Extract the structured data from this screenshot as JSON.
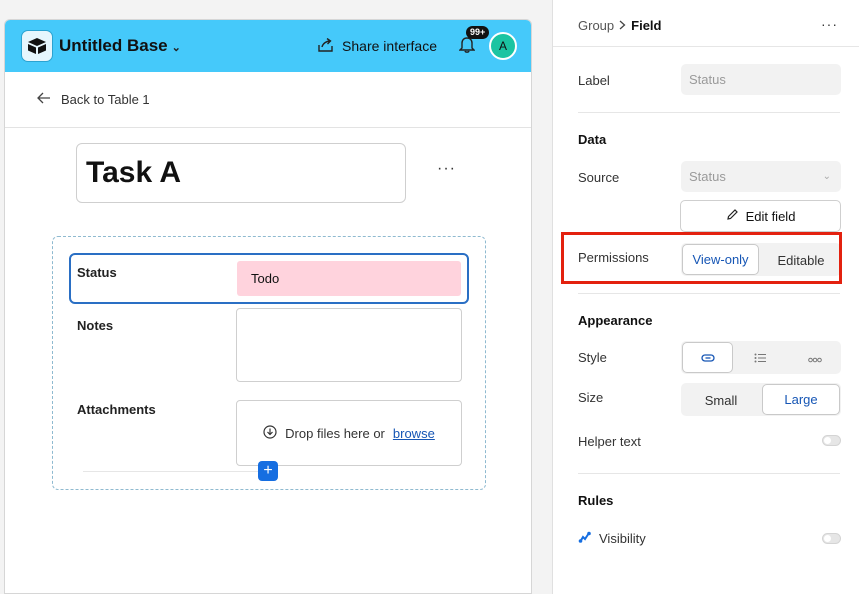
{
  "app": {
    "base_name": "Untitled Base",
    "share_label": "Share interface",
    "notification_count": "99+",
    "avatar_initial": "A"
  },
  "preview": {
    "back_link": "Back to Table 1",
    "record_title": "Task A",
    "more_label": "···",
    "fields": [
      {
        "label": "Status",
        "value": "Todo"
      },
      {
        "label": "Notes",
        "value": ""
      },
      {
        "label": "Attachments",
        "drop_text": "Drop files here or",
        "browse_link": "browse"
      }
    ],
    "add_label": "+"
  },
  "panel": {
    "breadcrumb_parent": "Group",
    "breadcrumb_current": "Field",
    "more_label": "···",
    "label_title": "Label",
    "label_value": "Status",
    "data_section": "Data",
    "source_title": "Source",
    "source_value": "Status",
    "edit_field_label": "Edit field",
    "permissions_title": "Permissions",
    "permissions_options": [
      "View-only",
      "Editable"
    ],
    "permissions_selected": "View-only",
    "appearance_section": "Appearance",
    "style_title": "Style",
    "style_options": [
      "link-icon",
      "list-icon",
      "pills-icon"
    ],
    "size_title": "Size",
    "size_options": [
      "Small",
      "Large"
    ],
    "size_selected": "Large",
    "helper_text_title": "Helper text",
    "helper_text_enabled": false,
    "rules_section": "Rules",
    "visibility_title": "Visibility",
    "visibility_enabled": false
  },
  "colors": {
    "topbar": "#45c9fa",
    "status_pill": "#ffd3dd",
    "accent": "#166ee1",
    "highlight": "#e3210f"
  }
}
